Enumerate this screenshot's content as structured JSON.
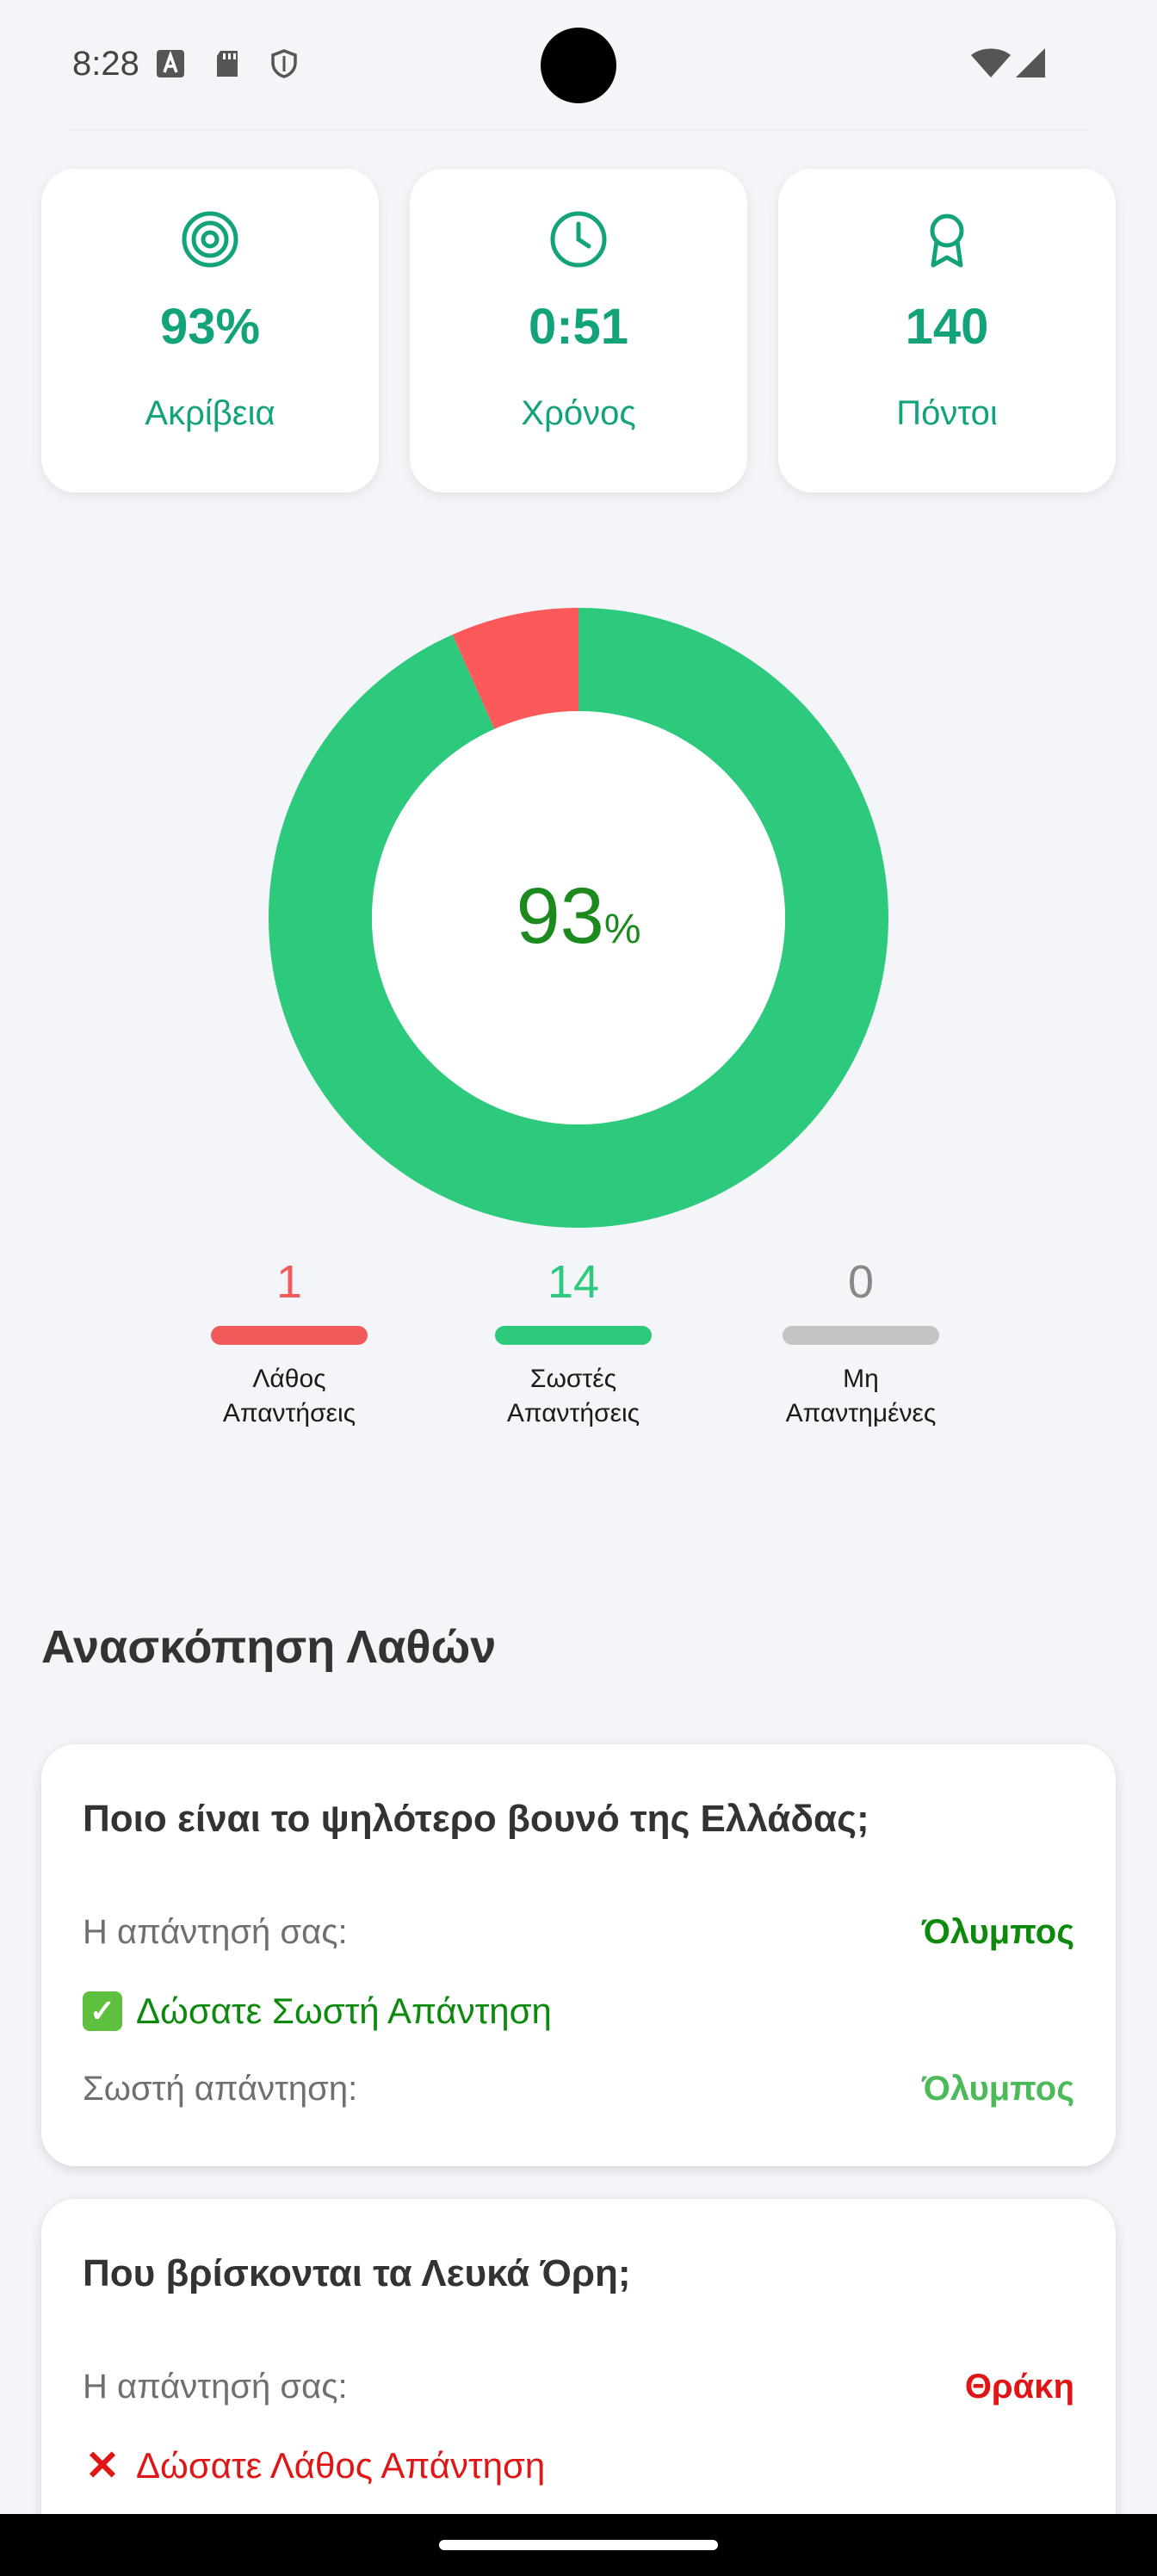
{
  "status_bar": {
    "time": "8:28"
  },
  "stats": [
    {
      "icon": "target-icon",
      "value": "93%",
      "label": "Ακρίβεια"
    },
    {
      "icon": "clock-icon",
      "value": "0:51",
      "label": "Χρόνος"
    },
    {
      "icon": "award-icon",
      "value": "140",
      "label": "Πόντοι"
    }
  ],
  "donut": {
    "percent": "93",
    "percent_sign": "%"
  },
  "chart_data": {
    "type": "pie",
    "categories": [
      "Λάθος Απαντήσεις",
      "Σωστές Απαντήσεις",
      "Μη Απαντημένες"
    ],
    "values": [
      1,
      14,
      0
    ],
    "colors": [
      "#fc5a5a",
      "#2dc97c",
      "#c4c4c4"
    ]
  },
  "legend": [
    {
      "value": "1",
      "line1": "Λάθος",
      "line2": "Απαντήσεις",
      "color": "#f05a5a"
    },
    {
      "value": "14",
      "line1": "Σωστές",
      "line2": "Απαντήσεις",
      "color": "#2dc97c"
    },
    {
      "value": "0",
      "line1": "Μη",
      "line2": "Απαντημένες",
      "color": "#888888"
    }
  ],
  "review": {
    "title": "Ανασκόπηση Λαθών",
    "items": [
      {
        "question": "Ποιο είναι το ψηλότερο βουνό της Ελλάδας;",
        "your_answer_label": "Η απάντησή σας:",
        "your_answer": "Όλυμπος",
        "verdict": "Δώσατε Σωστή Απάντηση",
        "correct_label": "Σωστή απάντηση:",
        "correct_answer": "Όλυμπος"
      },
      {
        "question": "Που βρίσκονται τα Λευκά Όρη;",
        "your_answer_label": "Η απάντησή σας:",
        "your_answer": "Θράκη",
        "verdict": "Δώσατε Λάθος Απάντηση"
      }
    ]
  }
}
